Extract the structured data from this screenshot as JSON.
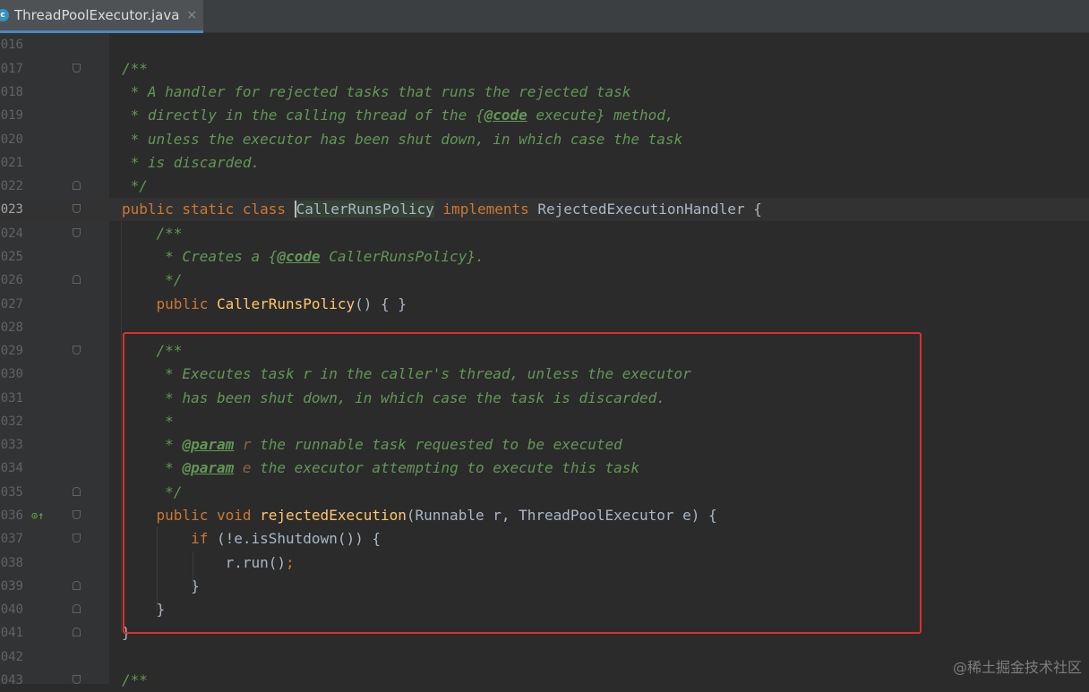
{
  "tab": {
    "icon_letter": "c",
    "title": "ThreadPoolExecutor.java",
    "close": "×"
  },
  "lines": [
    {
      "n": "016",
      "code": ""
    },
    {
      "n": "017",
      "code": "/**"
    },
    {
      "n": "018",
      "code": " * A handler for rejected tasks that runs the rejected task"
    },
    {
      "n": "019",
      "code": " * directly in the calling thread of the {@code execute} method,"
    },
    {
      "n": "020",
      "code": " * unless the executor has been shut down, in which case the task"
    },
    {
      "n": "021",
      "code": " * is discarded."
    },
    {
      "n": "022",
      "code": " */"
    },
    {
      "n": "023",
      "code": "public static class CallerRunsPolicy implements RejectedExecutionHandler {"
    },
    {
      "n": "024",
      "code": "    /**"
    },
    {
      "n": "025",
      "code": "     * Creates a {@code CallerRunsPolicy}."
    },
    {
      "n": "026",
      "code": "     */"
    },
    {
      "n": "027",
      "code": "    public CallerRunsPolicy() { }"
    },
    {
      "n": "028",
      "code": ""
    },
    {
      "n": "029",
      "code": "    /**"
    },
    {
      "n": "030",
      "code": "     * Executes task r in the caller's thread, unless the executor"
    },
    {
      "n": "031",
      "code": "     * has been shut down, in which case the task is discarded."
    },
    {
      "n": "032",
      "code": "     *"
    },
    {
      "n": "033",
      "code": "     * @param r the runnable task requested to be executed"
    },
    {
      "n": "034",
      "code": "     * @param e the executor attempting to execute this task"
    },
    {
      "n": "035",
      "code": "     */"
    },
    {
      "n": "036",
      "code": "    public void rejectedExecution(Runnable r, ThreadPoolExecutor e) {"
    },
    {
      "n": "037",
      "code": "        if (!e.isShutdown()) {"
    },
    {
      "n": "038",
      "code": "            r.run();"
    },
    {
      "n": "039",
      "code": "        }"
    },
    {
      "n": "040",
      "code": "    }"
    },
    {
      "n": "041",
      "code": "}"
    },
    {
      "n": "042",
      "code": ""
    },
    {
      "n": "043",
      "code": "/**"
    }
  ],
  "watermark": "@稀土掘金技术社区",
  "colors": {
    "comment": "#629755",
    "keyword": "#cc7832",
    "method": "#ffc66d",
    "text": "#a9b7c6",
    "highlight_box": "#e02d2d"
  }
}
